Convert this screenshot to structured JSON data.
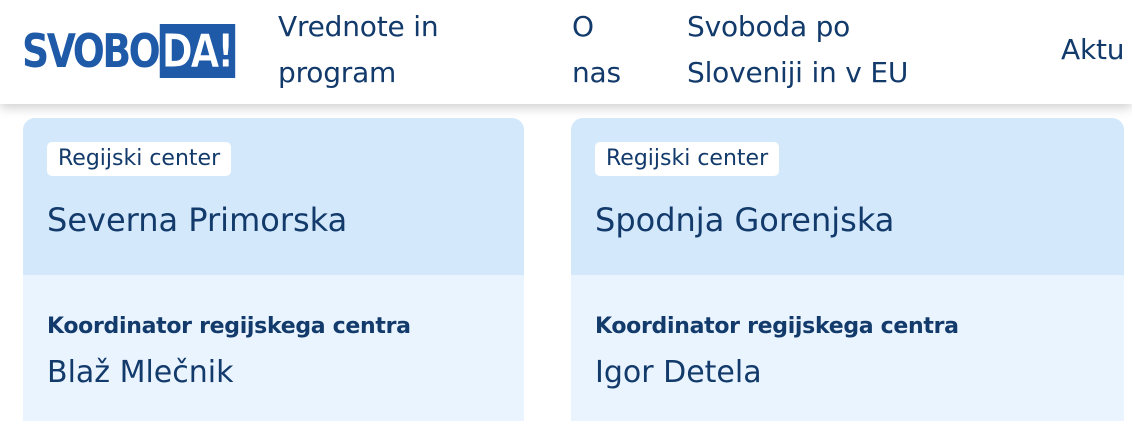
{
  "header": {
    "logo": {
      "part1": "SVOBO",
      "part2": "DA!"
    },
    "nav": [
      {
        "line1": "Vrednote in",
        "line2": "program"
      },
      {
        "line1": "O",
        "line2": "nas"
      },
      {
        "line1": "Svoboda po",
        "line2": "Sloveniji in v EU"
      },
      {
        "line1": "Aktu",
        "line2": ""
      }
    ]
  },
  "cards": [
    {
      "tag": "Regijski center",
      "title": "Severna Primorska",
      "role_label": "Koordinator regijskega centra",
      "person": "Blaž Mlečnik"
    },
    {
      "tag": "Regijski center",
      "title": "Spodnja Gorenjska",
      "role_label": "Koordinator regijskega centra",
      "person": "Igor Detela"
    }
  ],
  "colors": {
    "brand_blue": "#1e5aa8",
    "text_navy": "#123a6b",
    "card_top": "#d4e8fb",
    "card_body": "#eaf4fe"
  }
}
